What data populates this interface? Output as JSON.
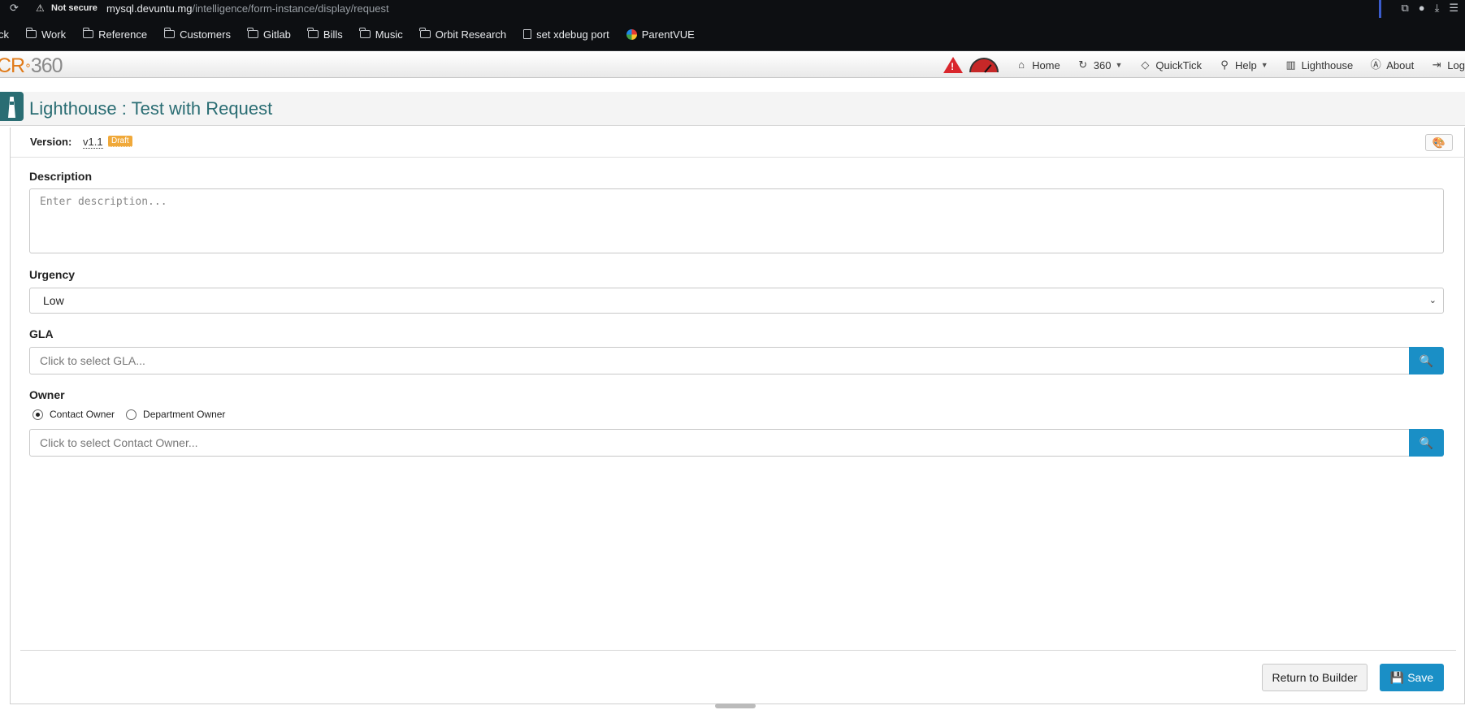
{
  "browser": {
    "not_secure_label": "Not secure",
    "url_host": "mysql.devuntu.mg",
    "url_path": "/intelligence/form-instance/display/request",
    "bookmarks": [
      {
        "label": "ck",
        "icon": "none"
      },
      {
        "label": "Work",
        "icon": "folder-icon"
      },
      {
        "label": "Reference",
        "icon": "folder-icon"
      },
      {
        "label": "Customers",
        "icon": "folder-icon"
      },
      {
        "label": "Gitlab",
        "icon": "folder-icon"
      },
      {
        "label": "Bills",
        "icon": "folder-icon"
      },
      {
        "label": "Music",
        "icon": "folder-icon"
      },
      {
        "label": "Orbit Research",
        "icon": "folder-icon"
      },
      {
        "label": "set xdebug port",
        "icon": "page-icon"
      },
      {
        "label": "ParentVUE",
        "icon": "parentvue-icon"
      }
    ]
  },
  "app": {
    "logo_cr": "CR",
    "logo_360": "360",
    "nav": {
      "home": "Home",
      "n360": "360",
      "quicktick": "QuickTick",
      "help": "Help",
      "lighthouse": "Lighthouse",
      "about": "About",
      "logout": "Logout"
    },
    "colors": {
      "accent": "#2a6d73",
      "brand_orange": "#e07b1a",
      "primary_button": "#1a8fc6",
      "draft_badge": "#f0a93a"
    }
  },
  "page": {
    "title": "Lighthouse : Test with Request",
    "version_label": "Version:",
    "version_value": "v1.1",
    "status_badge": "Draft"
  },
  "form": {
    "description": {
      "label": "Description",
      "placeholder": "Enter description..."
    },
    "urgency": {
      "label": "Urgency",
      "selected": "Low"
    },
    "gla": {
      "label": "GLA",
      "placeholder": "Click to select GLA..."
    },
    "owner": {
      "label": "Owner",
      "options": [
        {
          "label": "Contact Owner",
          "selected": true
        },
        {
          "label": "Department Owner",
          "selected": false
        }
      ],
      "placeholder": "Click to select Contact Owner..."
    }
  },
  "footer": {
    "return_label": "Return to Builder",
    "save_label": "Save"
  }
}
